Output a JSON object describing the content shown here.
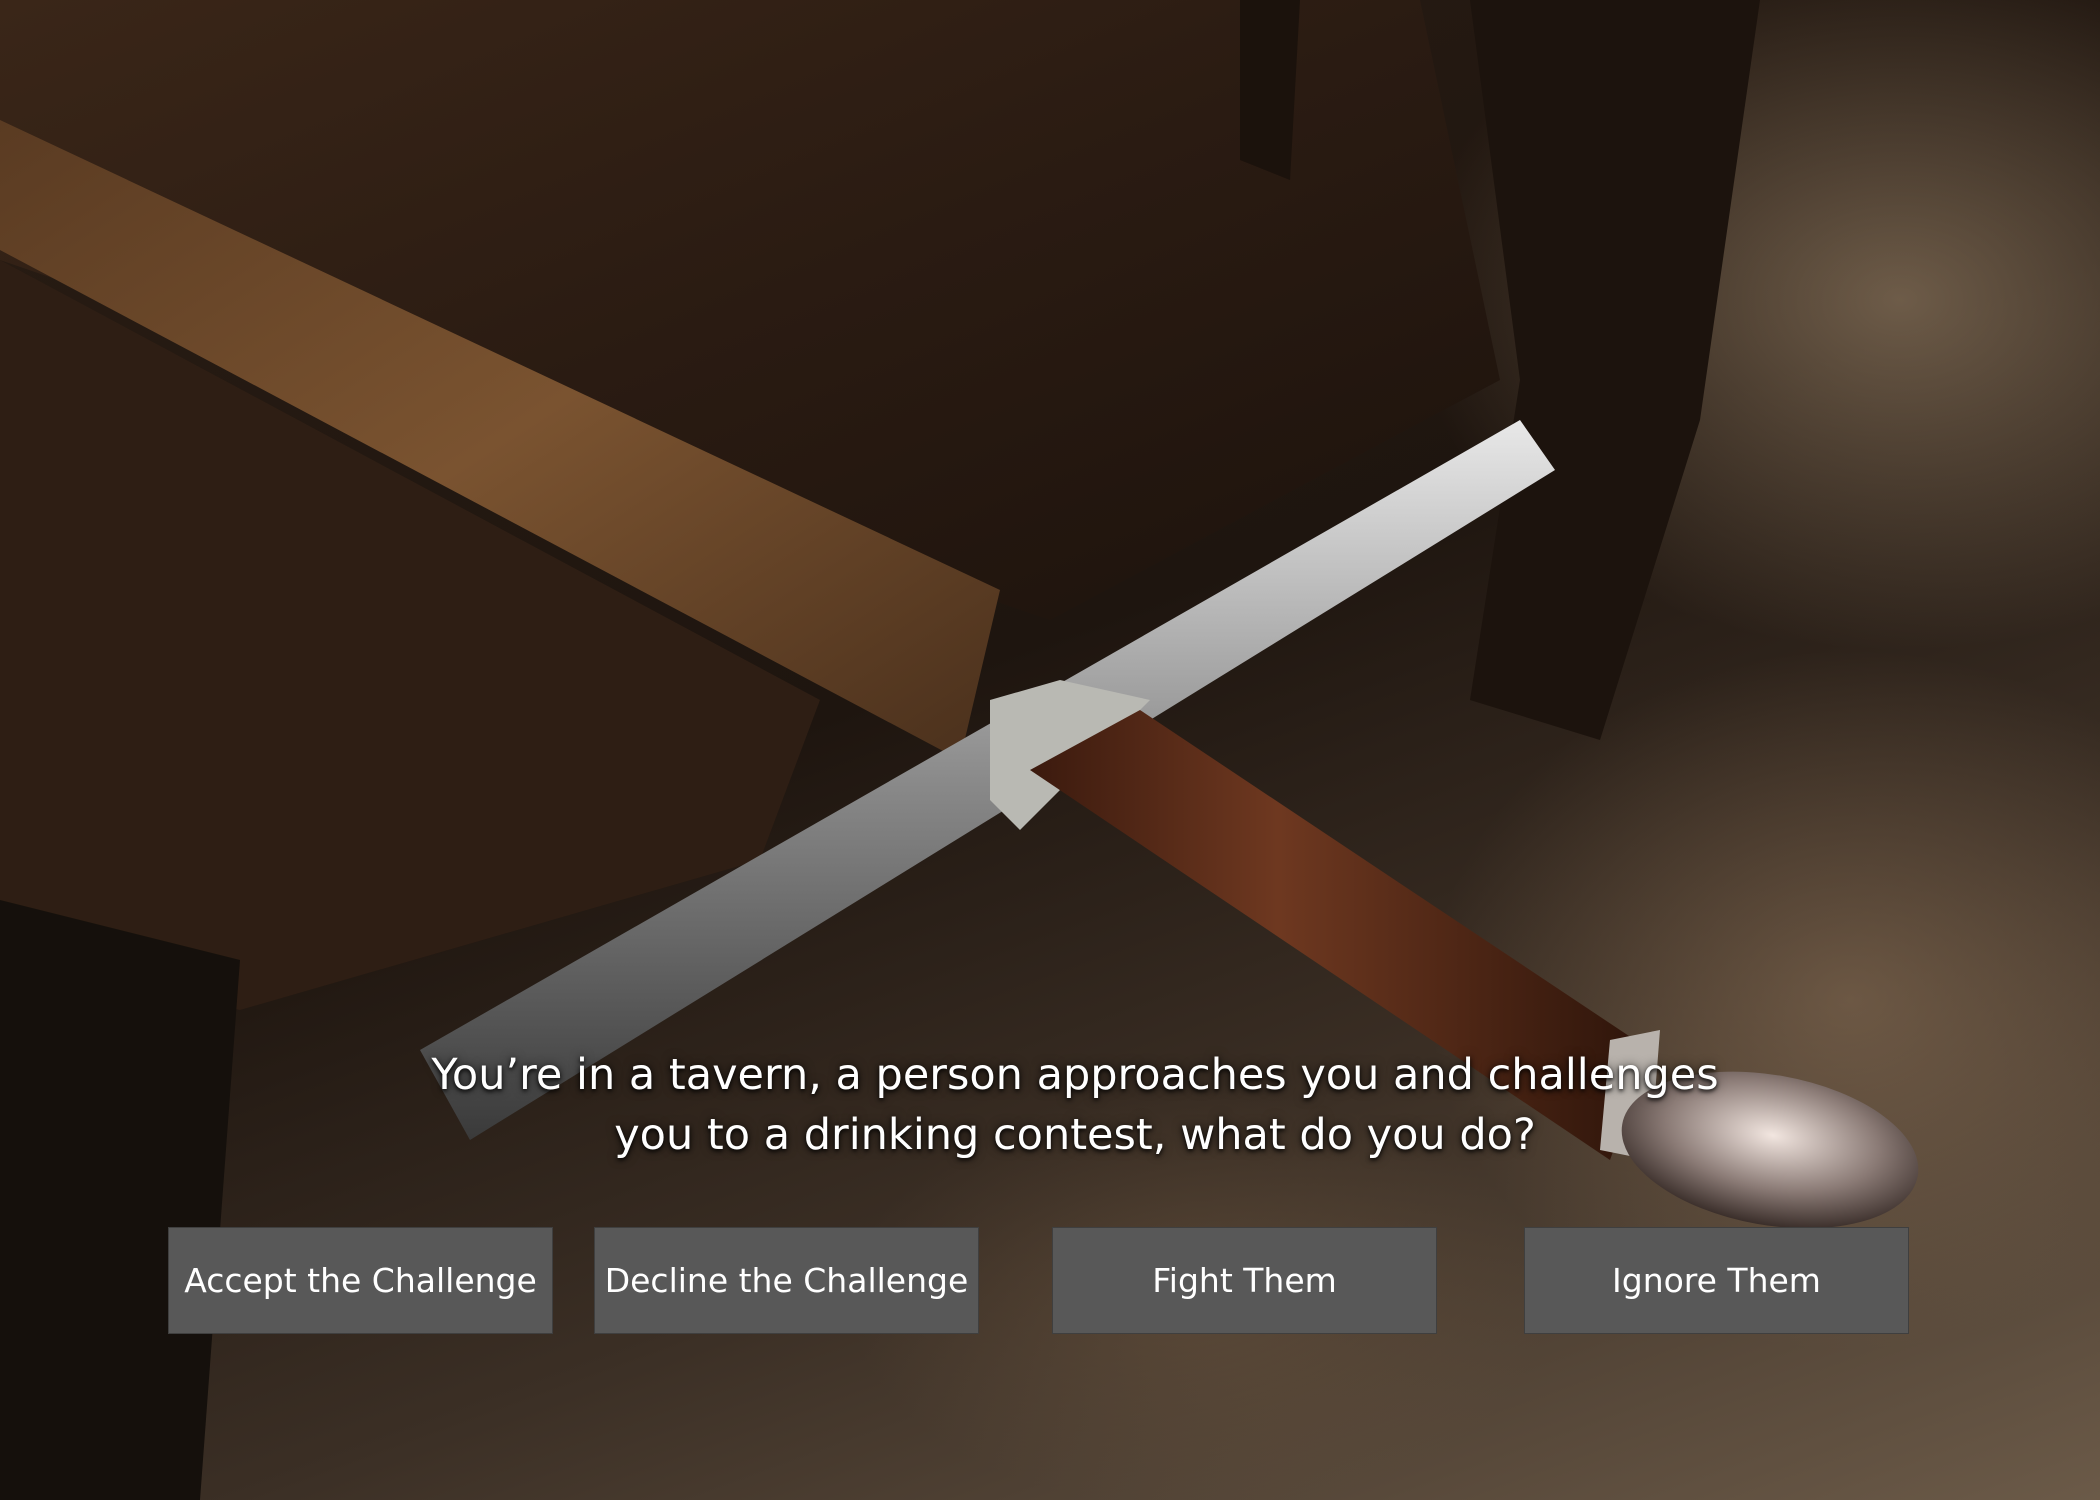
{
  "scene": {
    "image_subject": "sword-on-wooden-bench",
    "palette": {
      "wood_dark": "#2b1d14",
      "wood_mid": "#5a3a22",
      "blade": "#6b4a2c",
      "steel": "#c9c9c9",
      "grip": "#5e2f1a",
      "button_bg": "#585858",
      "text": "#ffffff"
    }
  },
  "prompt": {
    "text": "You’re in a tavern, a person approaches you and challenges\nyou to a drinking contest, what do you do?"
  },
  "choices": [
    {
      "label": "Accept the Challenge"
    },
    {
      "label": "Decline the Challenge"
    },
    {
      "label": "Fight Them"
    },
    {
      "label": "Ignore Them"
    }
  ]
}
